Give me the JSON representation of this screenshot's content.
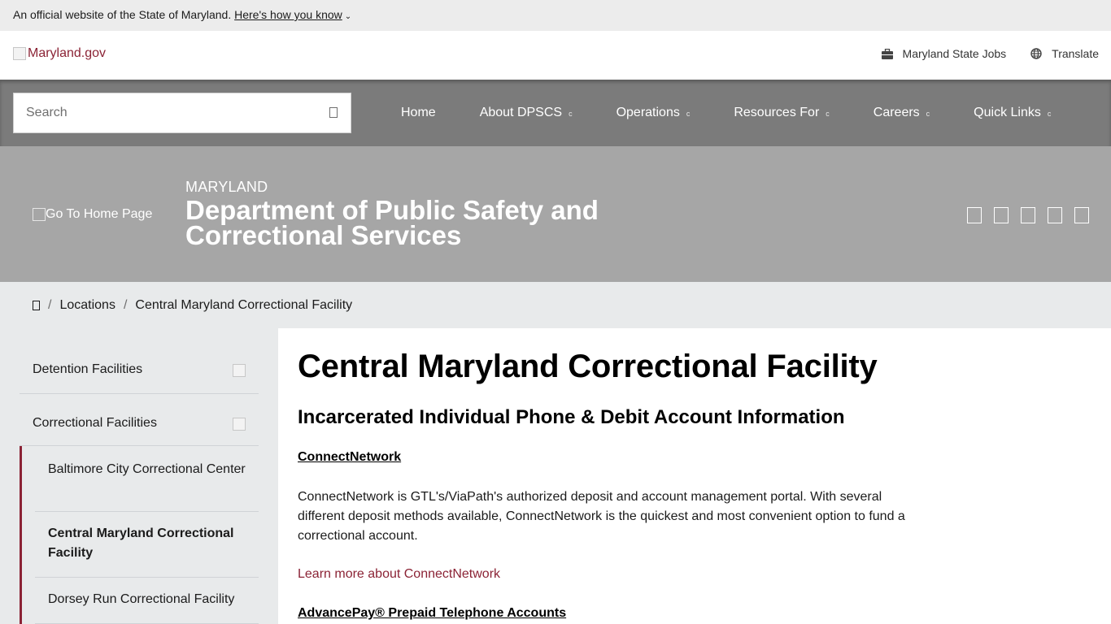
{
  "official_banner": {
    "text": "An official website of the State of Maryland.",
    "link": "Here's how you know",
    "chevron": "⌄"
  },
  "utility": {
    "logo_alt": "Maryland.gov",
    "links": [
      {
        "label": "Maryland State Jobs",
        "icon": "briefcase-icon"
      },
      {
        "label": "Translate",
        "icon": "globe-icon"
      }
    ]
  },
  "search": {
    "placeholder": "Search"
  },
  "nav": {
    "items": [
      {
        "label": "Home",
        "has_caret": false
      },
      {
        "label": "About DPSCS",
        "has_caret": true
      },
      {
        "label": "Operations",
        "has_caret": true
      },
      {
        "label": "Resources For",
        "has_caret": true
      },
      {
        "label": "Careers",
        "has_caret": true
      },
      {
        "label": "Quick Links",
        "has_caret": true
      }
    ],
    "caret": "c"
  },
  "hero": {
    "home_alt": "Go To Home Page",
    "state": "MARYLAND",
    "department": "Department of Public Safety and Correctional Services",
    "social_icons": [
      "facebook-icon",
      "twitter-icon",
      "instagram-icon",
      "youtube-icon",
      "linkedin-icon"
    ]
  },
  "breadcrumb": {
    "separator": "/",
    "items": [
      "Locations",
      "Central Maryland Correctional Facility"
    ]
  },
  "sidebar": {
    "items": [
      {
        "label": "Detention Facilities"
      },
      {
        "label": "Correctional Facilities"
      }
    ],
    "subitems": [
      {
        "label": "Baltimore City Correctional Center"
      },
      {
        "label": "Central Maryland Correctional Facility",
        "active": true
      },
      {
        "label": "Dorsey Run Correctional Facility"
      }
    ]
  },
  "main": {
    "title": "Central Maryland Correctional Facility",
    "subtitle": "Incarcerated Individual Phone & Debit Account Information",
    "section1_heading": "ConnectNetwork",
    "section1_body": "ConnectNetwork is GTL's/ViaPath's authorized deposit and account management portal. With several different deposit methods available, ConnectNetwork is the quickest and most convenient option to fund a correctional account.",
    "section1_link": "Learn more about ConnectNetwork",
    "section2_heading": "AdvancePay® Prepaid Telephone Accounts"
  },
  "colors": {
    "accent": "#8b2335",
    "nav_bg": "#7b7b7b",
    "hero_bg": "#a6a6a6",
    "band_bg": "#e8eaeb",
    "official_bg": "#ececec"
  }
}
